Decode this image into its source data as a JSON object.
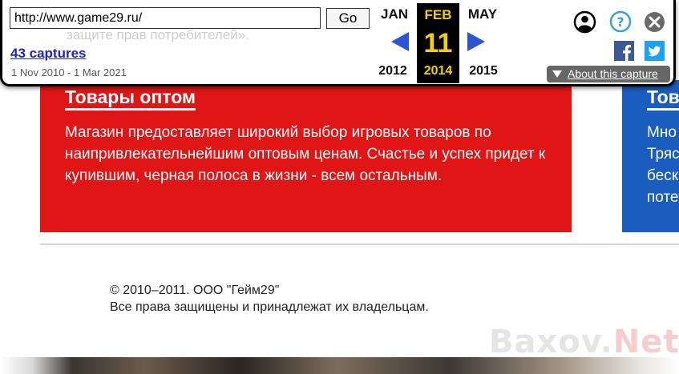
{
  "toolbar": {
    "url_value": "http://www.game29.ru/",
    "go_label": "Go",
    "captures_label": "43 captures",
    "date_range": "1 Nov 2010 - 1 Mar 2021",
    "prev_month": "JAN",
    "current_month": "FEB",
    "next_month": "MAY",
    "current_day": "11",
    "prev_year": "2012",
    "current_year": "2014",
    "next_year": "2015",
    "about_label": "About this capture",
    "icons": [
      "user-icon",
      "help-icon",
      "close-icon",
      "facebook-icon",
      "twitter-icon"
    ],
    "accent_color": "#2a55d6",
    "highlight_color": "#f4d000"
  },
  "page": {
    "ghost_text": "защите прав потребителей».",
    "red_block": {
      "title": "Товары оптом",
      "text": "Магазин предоставляет широкий выбор игровых товаров по наипривлекательнейшим оптовым ценам. Счастье и успех придет к купившим, черная полоса в жизни - всем остальным.",
      "color": "#e01515"
    },
    "blue_block": {
      "title": "Тов",
      "text": "Мно\nТряс\nбеск\nпоте",
      "color": "#1a5dbf"
    },
    "footer_line1": "© 2010–2011. ООО \"Гейм29\"",
    "footer_line2": "Все права защищены и принадлежат их владельцам.",
    "watermark_a": "Baxov.",
    "watermark_b": "Net"
  }
}
